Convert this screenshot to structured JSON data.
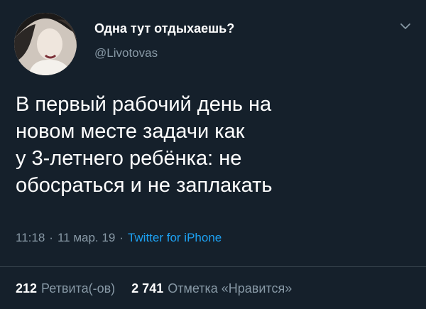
{
  "tweet": {
    "display_name": "Одна тут отдыхаешь?",
    "handle": "@Livotovas",
    "text_lines": [
      "В первый рабочий день на",
      "новом месте задачи как",
      "у 3-летнего ребёнка: не",
      "обосраться и не заплакать"
    ],
    "time": "11:18",
    "date": "11 мар. 19",
    "source": "Twitter for iPhone",
    "retweets": {
      "count": "212",
      "label": "Ретвита(-ов)"
    },
    "likes": {
      "count": "2 741",
      "label": "Отметка «Нравится»"
    }
  },
  "icons": {
    "menu": "chevron-down-icon"
  },
  "colors": {
    "background": "#15202b",
    "secondary_text": "#8899a6",
    "accent": "#1da1f2",
    "divider": "#38444d"
  }
}
